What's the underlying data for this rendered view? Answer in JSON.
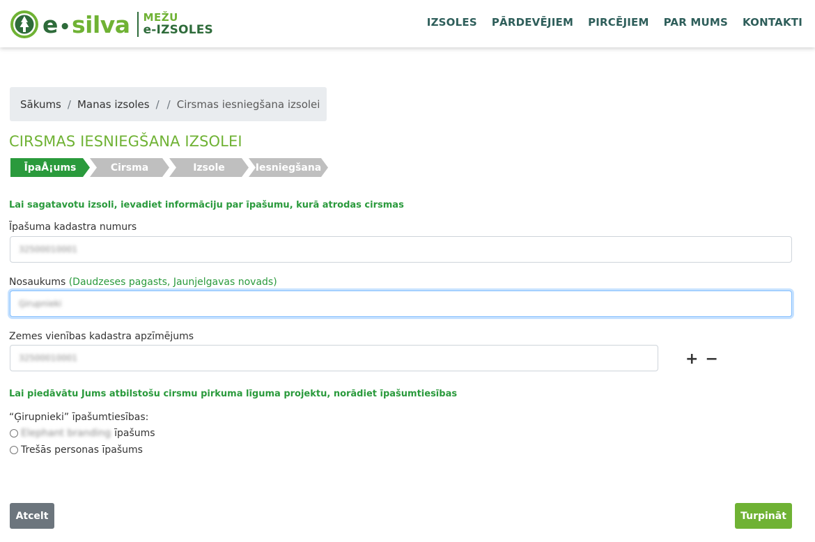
{
  "header": {
    "logo": {
      "e": "e",
      "dot": "•",
      "silva": "silva",
      "sub1": "MEŽU",
      "sub2": "e-IZSOLES"
    },
    "nav": [
      "IZSOLES",
      "PĀRDEVĒJIEM",
      "PIRCĒJIEM",
      "PAR MUMS",
      "KONTAKTI"
    ]
  },
  "breadcrumb": {
    "items": [
      "Sākums",
      "Manas izsoles",
      ""
    ],
    "active": "Cirsmas iesniegšana izsolei",
    "separator": "/"
  },
  "page_title": "CIRSMAS IESNIEGŠANA IZSOLEI",
  "steps": [
    "ĪpaÅ¡ums",
    "Cirsma",
    "Izsole",
    "Iesniegšana"
  ],
  "form": {
    "intro_note": "Lai sagatavotu izsoli, ievadiet informāciju par īpašumu, kurā atrodas cirsmas",
    "cadastre_label": "Īpašuma kadastra numurs",
    "cadastre_value": "32500010001",
    "name_label": "Nosaukums",
    "name_hint": "(Daudzeses pagasts, Jaunjelgavas novads)",
    "name_value": "Ģirupnieki",
    "land_unit_label": "Zemes vienības kadastra apzīmējums",
    "land_unit_value": "32500010001",
    "plus": "+",
    "minus": "−",
    "ownership_note": "Lai piedāvātu Jums atbilstošu cirsmu pirkuma līguma projektu, norādiet īpašumtiesības",
    "ownership_label": "“Ģirupnieki” īpašumtiesības:",
    "option1_blur": "Elephant branding",
    "option1_suffix": "īpašums",
    "option2": "Trešās personas īpašums"
  },
  "buttons": {
    "cancel": "Atcelt",
    "next": "Turpināt"
  },
  "colors": {
    "brand_green": "#6fb234",
    "step_active": "#2a9a3c",
    "step_inactive": "#bfbfbf",
    "nav_text": "#2e5e5a"
  }
}
